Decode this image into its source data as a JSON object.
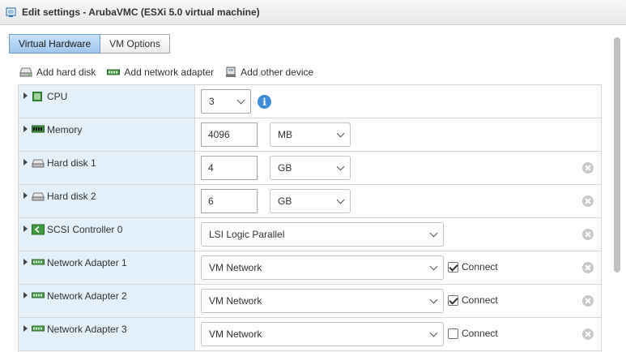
{
  "window": {
    "title": "Edit settings - ArubaVMC (ESXi 5.0 virtual machine)",
    "icon": "vm-settings-icon"
  },
  "tabs": [
    {
      "label": "Virtual Hardware",
      "active": true
    },
    {
      "label": "VM Options",
      "active": false
    }
  ],
  "toolbar": {
    "add_hard_disk": "Add hard disk",
    "add_network_adapter": "Add network adapter",
    "add_other_device": "Add other device"
  },
  "devices": {
    "cpu": {
      "label": "CPU",
      "value": "3",
      "icon": "cpu-icon"
    },
    "memory": {
      "label": "Memory",
      "value": "4096",
      "unit": "MB",
      "icon": "memory-icon"
    },
    "hard_disk_1": {
      "label": "Hard disk 1",
      "value": "4",
      "unit": "GB",
      "icon": "hard-disk-icon"
    },
    "hard_disk_2": {
      "label": "Hard disk 2",
      "value": "6",
      "unit": "GB",
      "icon": "hard-disk-icon"
    },
    "scsi_controller_0": {
      "label": "SCSI Controller 0",
      "value": "LSI Logic Parallel",
      "icon": "scsi-controller-icon"
    },
    "network_adapter_1": {
      "label": "Network Adapter 1",
      "network": "VM Network",
      "connect_label": "Connect",
      "connected": true,
      "icon": "network-adapter-icon"
    },
    "network_adapter_2": {
      "label": "Network Adapter 2",
      "network": "VM Network",
      "connect_label": "Connect",
      "connected": true,
      "icon": "network-adapter-icon"
    },
    "network_adapter_3": {
      "label": "Network Adapter 3",
      "network": "VM Network",
      "connect_label": "Connect",
      "connected": false,
      "icon": "network-adapter-icon"
    }
  },
  "colors": {
    "active_tab": "#9fc6ee",
    "label_column": "#e3eff9",
    "info_icon": "#3f8cd7"
  }
}
